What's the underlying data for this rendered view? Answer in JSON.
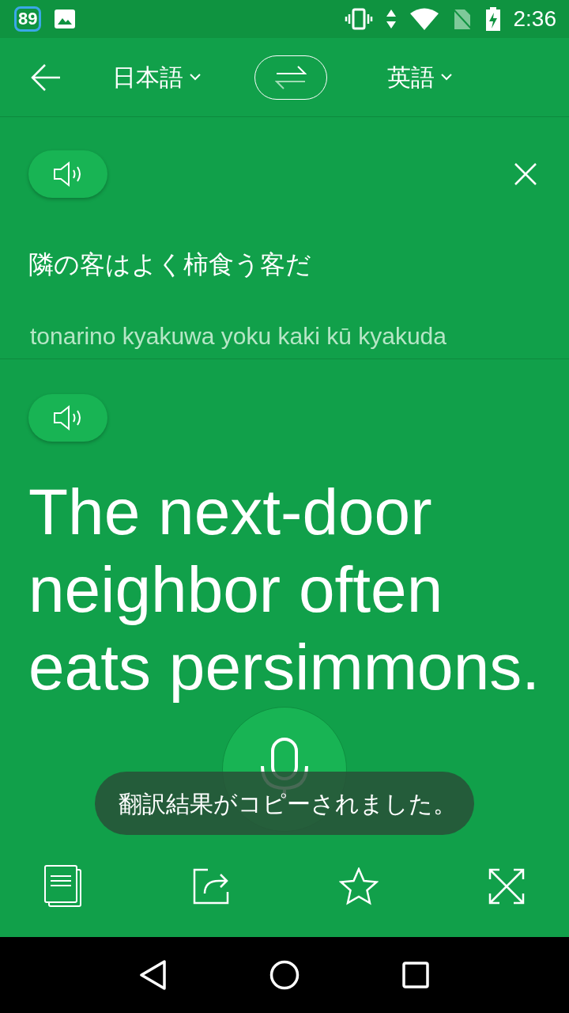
{
  "status_bar": {
    "notification_badge": "89",
    "time": "2:36"
  },
  "toolbar": {
    "source_language": "日本語",
    "target_language": "英語"
  },
  "source": {
    "text": "隣の客はよく柿食う客だ",
    "romanization": "tonarino kyakuwa yoku kaki kū kyakuda"
  },
  "target": {
    "text": "The next-door neighbor often eats persimmons."
  },
  "toast": {
    "text": "翻訳結果がコピーされました。"
  }
}
